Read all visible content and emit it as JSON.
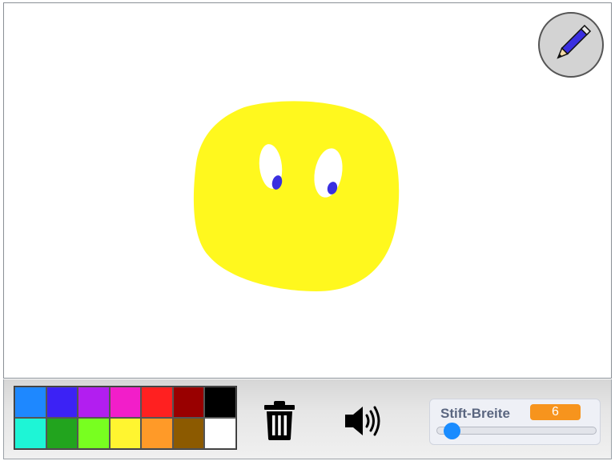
{
  "canvas": {
    "background": "#ffffff",
    "drawing": {
      "face_color": "#fff81e",
      "eye_color": "#ffffff",
      "pupil_color": "#3a2fe0"
    }
  },
  "pen_tool": {
    "icon": "pencil-icon"
  },
  "palette": {
    "colors": [
      "#1e88ff",
      "#3c22f5",
      "#b21ef0",
      "#f21ec9",
      "#ff2020",
      "#990000",
      "#000000",
      "#1ef5d6",
      "#22a41e",
      "#78ff20",
      "#fff530",
      "#ff9a28",
      "#8c5a00",
      "#ffffff"
    ]
  },
  "actions": {
    "trash_icon": "trash-icon",
    "sound_icon": "speaker-icon"
  },
  "pen_width": {
    "label": "Stift-Breite",
    "value": "6",
    "level": 0.05
  }
}
